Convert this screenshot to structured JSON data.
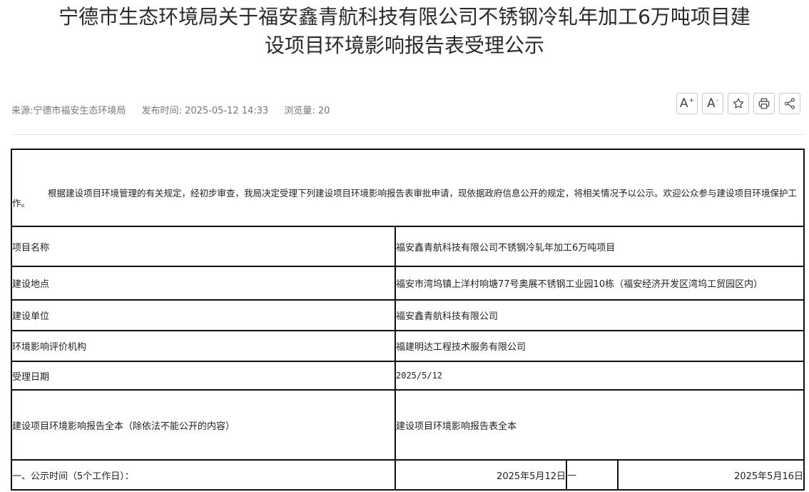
{
  "article": {
    "title_line1": "宁德市生态环境局关于福安鑫青航科技有限公司不锈钢冷轧年加工6万吨项目建",
    "title_line2": "设项目环境影响报告表受理公示",
    "source": "来源:宁德市福安生态环境局",
    "publish_time": "发布时间: 2025-05-12 14:33",
    "views": "浏览量: 20"
  },
  "tools": {
    "font_larger": "A",
    "font_smaller": "A",
    "plus": "+",
    "minus": "-"
  },
  "table": {
    "intro": "根据建设项目环境管理的有关规定，经初步审查，我局决定受理下列建设项目环境影响报告表审批申请，现依据政府信息公开的规定，将相关情况予以公示。欢迎公众参与建设项目环境保护工作。",
    "rows": [
      {
        "label": "项目名称",
        "value": "福安鑫青航科技有限公司不锈钢冷轧年加工6万吨项目"
      },
      {
        "label": "建设地点",
        "value": "福安市湾坞镇上洋村响塘77号奥展不锈钢工业园10栋（福安经济开发区湾坞工贸园区内）"
      },
      {
        "label": "建设单位",
        "value": "福安鑫青航科技有限公司"
      },
      {
        "label": "环境影响评价机构",
        "value": "福建明达工程技术服务有限公司"
      },
      {
        "label": "受理日期",
        "value": "2025/5/12"
      },
      {
        "label": "建设项目环境影响报告全本（除依法不能公开的内容）",
        "value": "建设项目环境影响报告表全本"
      }
    ],
    "publicity": {
      "label": "一、公示时间（5个工作日）：",
      "start": "2025年5月12日",
      "separator": "—",
      "end": "2025年5月16日"
    }
  }
}
